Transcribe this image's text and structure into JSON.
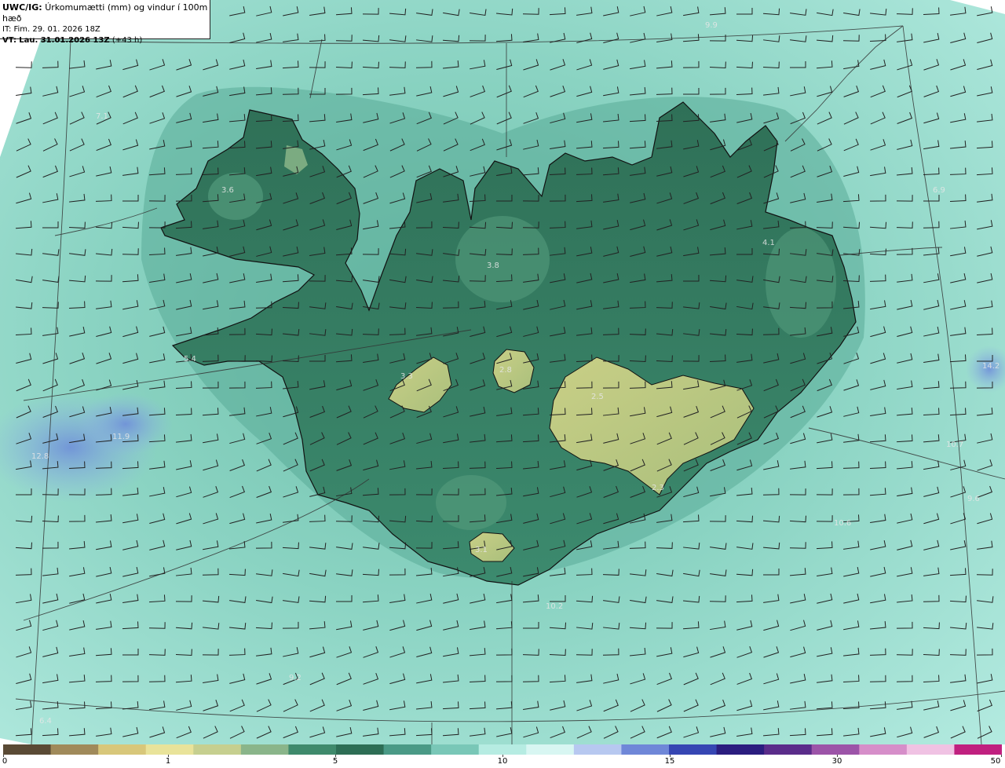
{
  "header": {
    "model_label": "UWC/IG:",
    "product_title": "Úrkomumætti (mm) og vindur í 100m hæð",
    "init_time": "IT: Fim. 29. 01. 2026 18Z",
    "valid_label": "VT:",
    "valid_time": "Lau. 31.01.2026 13Z",
    "lead_time": "(+43 h)"
  },
  "colors": {
    "land_low": "#2d6e55",
    "land_high": "#b8c77d",
    "sea_near": "#5fb39f",
    "sea_far": "#b6ece2",
    "sea_heavy": "#7ea4dd",
    "coastline": "#111111",
    "grid_line": "#333333",
    "wind_barb": "#222222"
  },
  "map_values": [
    {
      "id": "v-9-9",
      "text": "9.9"
    },
    {
      "id": "v-7-1",
      "text": "7.1"
    },
    {
      "id": "v-3-6",
      "text": "3.6"
    },
    {
      "id": "v-3-8",
      "text": "3.8"
    },
    {
      "id": "v-6-9",
      "text": "6.9"
    },
    {
      "id": "v-4-1",
      "text": "4.1"
    },
    {
      "id": "v-5-4",
      "text": "5.4"
    },
    {
      "id": "v-3-3",
      "text": "3.3"
    },
    {
      "id": "v-2-8",
      "text": "2.8"
    },
    {
      "id": "v-2-5",
      "text": "2.5"
    },
    {
      "id": "v-11-9",
      "text": "11.9"
    },
    {
      "id": "v-12-8",
      "text": "12.8"
    },
    {
      "id": "v-2-3",
      "text": "2.3"
    },
    {
      "id": "v-10-7",
      "text": "10.7"
    },
    {
      "id": "v-9-6",
      "text": "9.6"
    },
    {
      "id": "v-10-6",
      "text": "10.6"
    },
    {
      "id": "v-3-1",
      "text": "3.1"
    },
    {
      "id": "v-10-2",
      "text": "10.2"
    },
    {
      "id": "v-9-2",
      "text": "9.2"
    },
    {
      "id": "v-6-4",
      "text": "6.4"
    },
    {
      "id": "v-14-2",
      "text": "14.2"
    }
  ],
  "colorbar": {
    "ticks": [
      {
        "label": "0"
      },
      {
        "label": "1"
      },
      {
        "label": "5"
      },
      {
        "label": "10"
      },
      {
        "label": "15"
      },
      {
        "label": "30"
      },
      {
        "label": "50"
      }
    ],
    "colors": [
      "#5a4a35",
      "#a08a5a",
      "#d8c77a",
      "#e9e39a",
      "#c6cf8f",
      "#8ab58a",
      "#3f8a6c",
      "#2d6e55",
      "#4a9a86",
      "#79c7b7",
      "#b6ece2",
      "#d8f6f2",
      "#b7c8f0",
      "#6f87d8",
      "#3646b3",
      "#2b1d7f",
      "#5a2c8a",
      "#9c54a8",
      "#d68ec9",
      "#f0c2e3",
      "#c0207f"
    ]
  }
}
